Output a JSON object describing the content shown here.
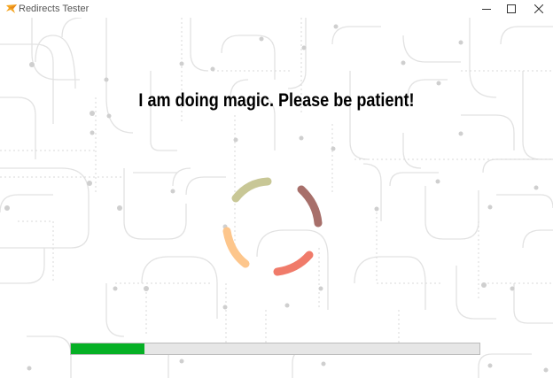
{
  "window": {
    "title": "Redirects Tester",
    "icon": "app-logo-icon",
    "controls": [
      "minimize-icon",
      "maximize-icon",
      "close-icon"
    ]
  },
  "main": {
    "message": "I am doing magic. Please be patient!"
  },
  "spinner": {
    "icon": "loading-spinner-icon",
    "colors": [
      "#c8c796",
      "#a76f6a",
      "#f07b6a",
      "#fdc68c"
    ]
  },
  "progress": {
    "value": 0.18,
    "fill_color": "#06b025",
    "track_color": "#e6e6e6"
  }
}
